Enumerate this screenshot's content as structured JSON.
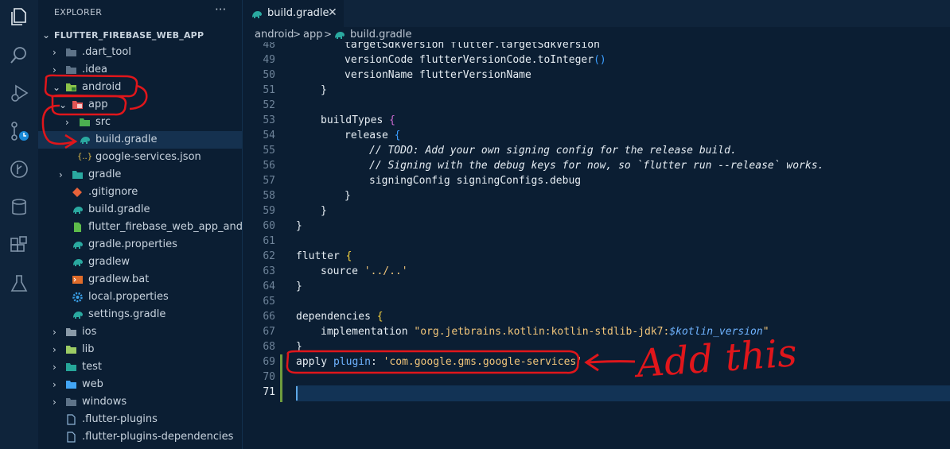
{
  "explorer": {
    "title": "EXPLORER",
    "more_label": "···",
    "root": "FLUTTER_FIREBASE_WEB_APP",
    "items": [
      {
        "label": ".dart_tool"
      },
      {
        "label": ".idea"
      },
      {
        "label": "android"
      },
      {
        "label": "app"
      },
      {
        "label": "src"
      },
      {
        "label": "build.gradle"
      },
      {
        "label": "google-services.json"
      },
      {
        "label": "gradle"
      },
      {
        "label": ".gitignore"
      },
      {
        "label": "build.gradle"
      },
      {
        "label": "flutter_firebase_web_app_andro..."
      },
      {
        "label": "gradle.properties"
      },
      {
        "label": "gradlew"
      },
      {
        "label": "gradlew.bat"
      },
      {
        "label": "local.properties"
      },
      {
        "label": "settings.gradle"
      },
      {
        "label": "ios"
      },
      {
        "label": "lib"
      },
      {
        "label": "test"
      },
      {
        "label": "web"
      },
      {
        "label": "windows"
      },
      {
        "label": ".flutter-plugins"
      },
      {
        "label": ".flutter-plugins-dependencies"
      }
    ]
  },
  "tab": {
    "label": "build.gradle",
    "close": "✕"
  },
  "breadcrumb": {
    "seg1": "android",
    "seg2": "app",
    "seg3": "build.gradle",
    "sep": ">"
  },
  "code": {
    "line_numbers": [
      "48",
      "49",
      "50",
      "51",
      "52",
      "53",
      "54",
      "55",
      "56",
      "57",
      "58",
      "59",
      "60",
      "61",
      "62",
      "63",
      "64",
      "65",
      "66",
      "67",
      "68",
      "69",
      "70",
      "71"
    ],
    "l48": "targetSdkVersion flutter.targetSdkVersion",
    "l49a": "versionCode flutterVersionCode.toInteger",
    "l49b": "()",
    "l50": "versionName flutterVersionName",
    "l51": "}",
    "l53a": "buildTypes ",
    "l53b": "{",
    "l54a": "release ",
    "l54b": "{",
    "l55": "// TODO: Add your own signing config for the release build.",
    "l56": "// Signing with the debug keys for now, so `flutter run --release` works.",
    "l57": "signingConfig signingConfigs.debug",
    "l58": "}",
    "l59": "}",
    "l60": "}",
    "l62a": "flutter ",
    "l62b": "{",
    "l63a": "source ",
    "l63b": "'../..'",
    "l64": "}",
    "l66a": "dependencies ",
    "l66b": "{",
    "l67a": "implementation ",
    "l67b": "\"org.jetbrains.kotlin:kotlin-stdlib-jdk7:",
    "l67c": "$kotlin_version",
    "l67d": "\"",
    "l68": "}",
    "l69a": "apply ",
    "l69b": "plugin",
    "l69c": ": ",
    "l69d": "'com.google.gms.google-services'"
  },
  "annotation": {
    "text": "Add this",
    "color": "#e0161b"
  },
  "colors": {
    "accent": "#3b9eff",
    "sidebar_bg": "#0b1e33",
    "annotation": "#e0161b"
  }
}
